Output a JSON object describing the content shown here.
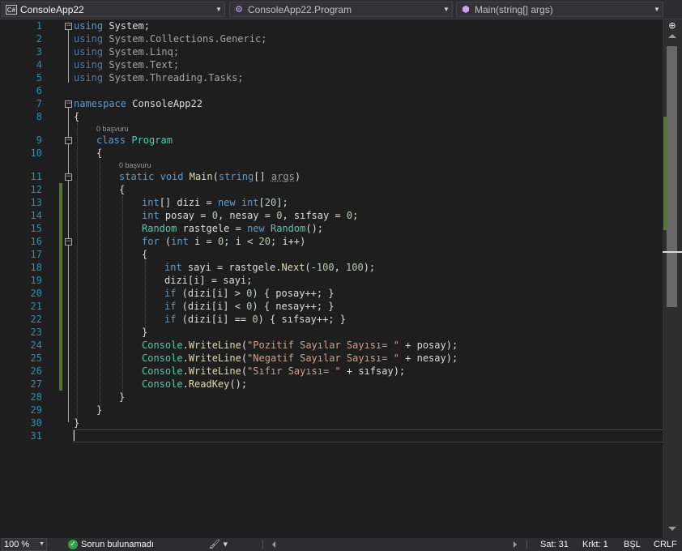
{
  "nav": {
    "project": "ConsoleApp22",
    "project_badge": "C#",
    "type": "ConsoleApp22.Program",
    "member": "Main(string[] args)"
  },
  "editor": {
    "line_numbers": [
      "1",
      "2",
      "3",
      "4",
      "5",
      "6",
      "7",
      "8",
      "9",
      "10",
      "11",
      "12",
      "13",
      "14",
      "15",
      "16",
      "17",
      "18",
      "19",
      "20",
      "21",
      "22",
      "23",
      "24",
      "25",
      "26",
      "27",
      "28",
      "29",
      "30",
      "31"
    ],
    "codelens_class": "0 başvuru",
    "codelens_method": "0 başvuru",
    "lines": {
      "l1": [
        "using",
        " System;"
      ],
      "l2": [
        "using",
        " System.Collections.Generic;"
      ],
      "l3": [
        "using",
        " System.Linq;"
      ],
      "l4": [
        "using",
        " System.Text;"
      ],
      "l5": [
        "using",
        " System.Threading.Tasks;"
      ],
      "l7": [
        "namespace",
        " ConsoleApp22"
      ],
      "l8": "{",
      "l9": [
        "class",
        "Program"
      ],
      "l10": "{",
      "l11": [
        "static",
        "void",
        "Main",
        "string",
        "args"
      ],
      "l12": "{",
      "l13": [
        "int",
        "[] dizi = ",
        "new",
        "int",
        "[",
        "20",
        "];"
      ],
      "l14": [
        "int",
        " posay = ",
        "0",
        ", nesay = ",
        "0",
        ", sıfsay = ",
        "0",
        ";"
      ],
      "l15": [
        "Random",
        " rastgele = ",
        "new",
        "Random",
        "();"
      ],
      "l16": [
        "for",
        " (",
        "int",
        " i = ",
        "0",
        "; i < ",
        "20",
        "; i++)"
      ],
      "l17": "{",
      "l18": [
        "int",
        " sayi = rastgele.",
        "Next",
        "(-",
        "100",
        ", ",
        "100",
        ");"
      ],
      "l19": "dizi[i] = sayi;",
      "l20": [
        "if",
        " (dizi[i] > ",
        "0",
        ") { posay++; }"
      ],
      "l21": [
        "if",
        " (dizi[i] < ",
        "0",
        ") { nesay++; }"
      ],
      "l22": [
        "if",
        " (dizi[i] == ",
        "0",
        ") { sıfsay++; }"
      ],
      "l23": "}",
      "l24": [
        "Console",
        ".",
        "WriteLine",
        "(",
        "\"Pozitif Sayılar Sayısı= \"",
        " + posay);"
      ],
      "l25": [
        "Console",
        ".",
        "WriteLine",
        "(",
        "\"Negatif Sayılar Sayısı= \"",
        " + nesay);"
      ],
      "l26": [
        "Console",
        ".",
        "WriteLine",
        "(",
        "\"Sıfır Sayısı= \"",
        " + sıfsay);"
      ],
      "l27": [
        "Console",
        ".",
        "ReadKey",
        "();"
      ],
      "l28": "}",
      "l29": "}",
      "l30": "}"
    }
  },
  "status": {
    "zoom": "100 %",
    "issues": "Sorun bulunamadı",
    "line": "Sat: 31",
    "column": "Krkt: 1",
    "insert_mode": "BŞL",
    "line_ending": "CRLF"
  },
  "colors": {
    "keyword": "#569cd6",
    "type": "#4ec9b0",
    "string": "#d69d85",
    "number": "#b5cea8",
    "method": "#dcdcaa",
    "line_number": "#2b91af",
    "change_bar": "#577430"
  }
}
